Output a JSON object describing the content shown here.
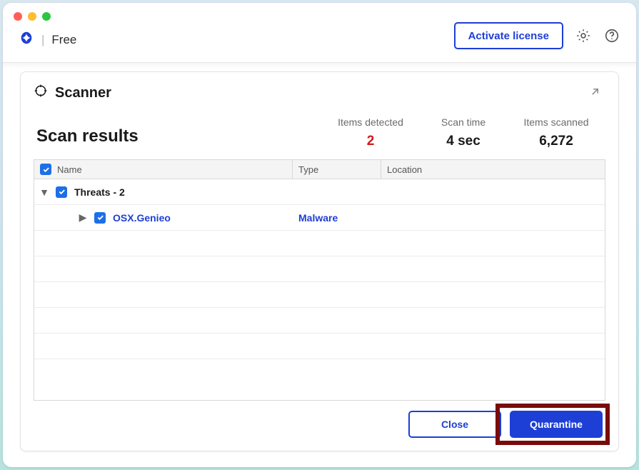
{
  "header": {
    "tier_label": "Free",
    "activate_label": "Activate license"
  },
  "panel": {
    "title": "Scanner",
    "results_title": "Scan results",
    "stats": {
      "detected_label": "Items detected",
      "detected_value": "2",
      "time_label": "Scan time",
      "time_value": "4 sec",
      "scanned_label": "Items scanned",
      "scanned_value": "6,272"
    },
    "columns": {
      "name": "Name",
      "type": "Type",
      "location": "Location"
    },
    "group": {
      "label": "Threats - 2"
    },
    "threat": {
      "name": "OSX.Genieo",
      "type": "Malware",
      "location": ""
    },
    "buttons": {
      "close": "Close",
      "quarantine": "Quarantine"
    }
  }
}
